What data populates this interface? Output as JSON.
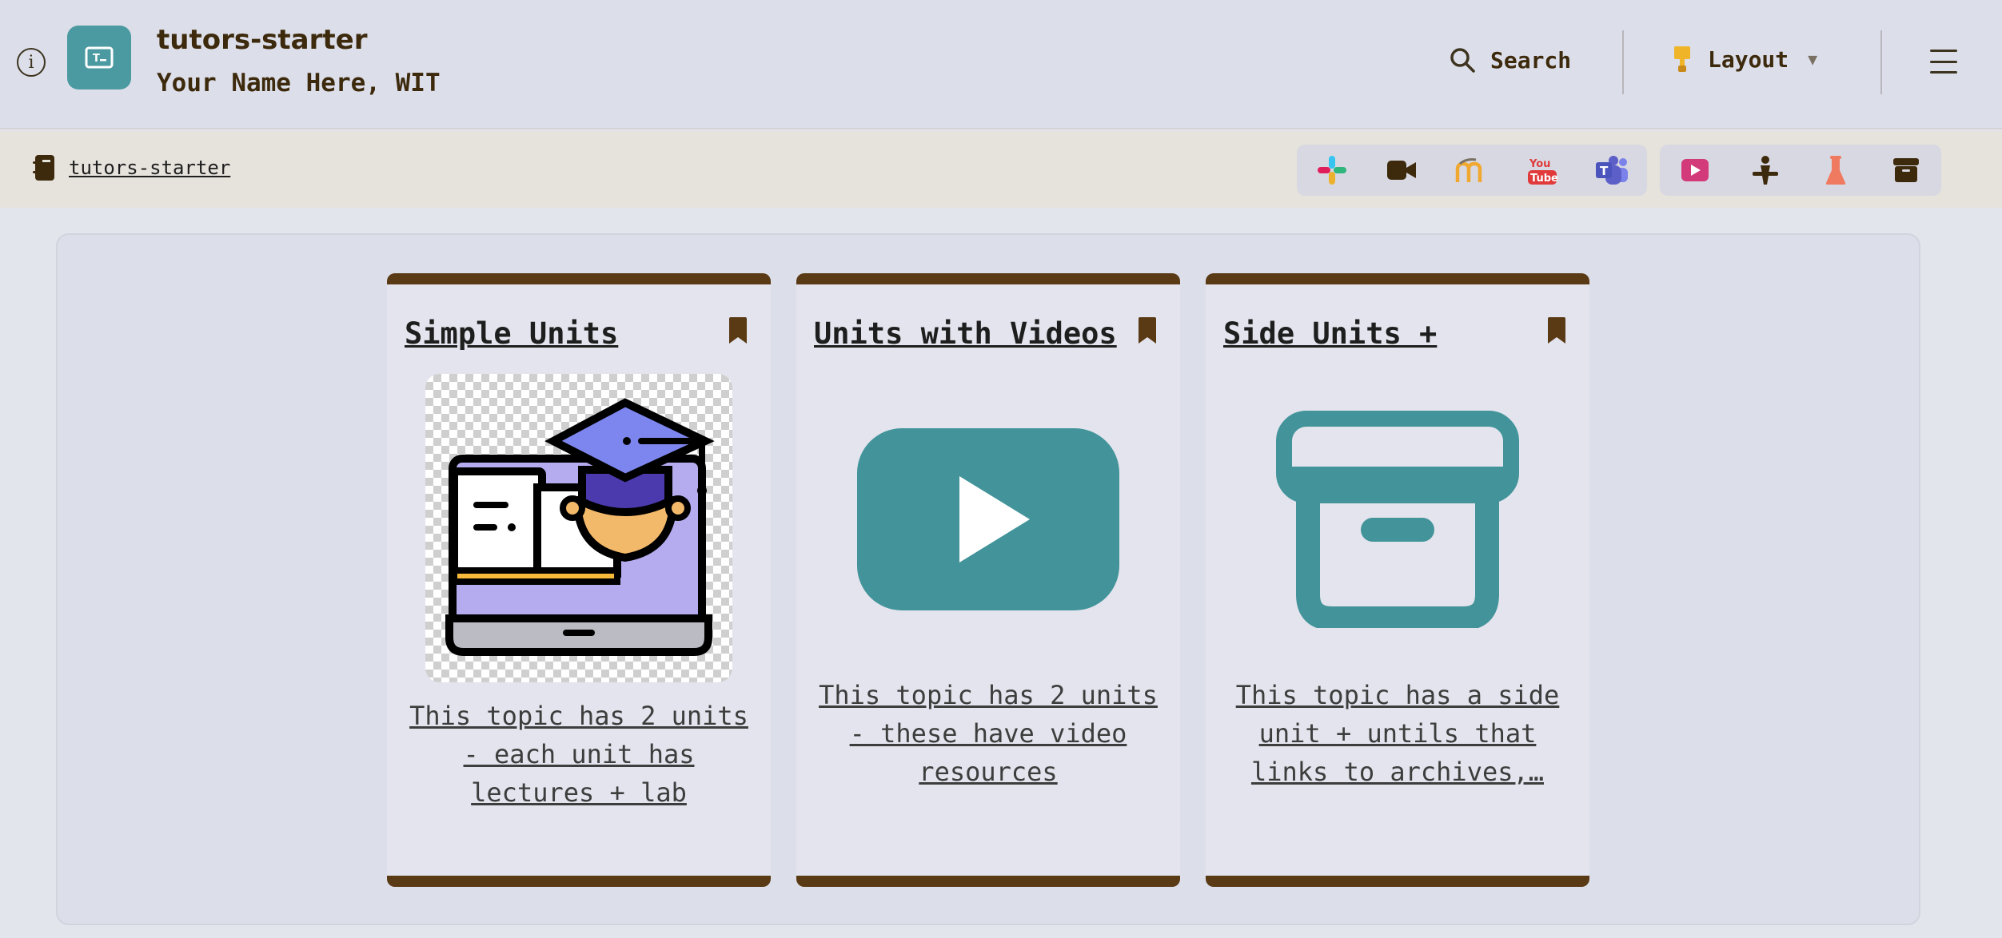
{
  "header": {
    "title": "tutors-starter",
    "subtitle": "Your Name Here, WIT",
    "search_label": "Search",
    "layout_label": "Layout",
    "icons": [
      "info-icon",
      "tutors-logo-icon",
      "search-icon",
      "paintbrush-icon",
      "chevron-down-icon",
      "menu-icon"
    ]
  },
  "breadcrumb": {
    "label": "tutors-starter",
    "icon": "notebook-icon"
  },
  "toolbar": {
    "group1": [
      "slack-icon",
      "video-camera-icon",
      "moodle-icon",
      "youtube-icon",
      "teams-icon"
    ],
    "group2": [
      "video-play-icon",
      "lab-station-icon",
      "flask-icon",
      "archive-icon"
    ],
    "colors": {
      "slack": "#e01e5a",
      "video": "#3d2a0d",
      "moodle": "#f0a830",
      "youtube": "#e03a3a",
      "teams": "#5b5fc7",
      "play": "#d23a7a",
      "lab": "#3d2a0d",
      "flask": "#f07a60",
      "archive": "#3d2a0d"
    }
  },
  "cards": [
    {
      "title": "Simple Units",
      "description": "This topic has 2 units - each unit has lectures + lab",
      "image": "graduate-laptop-illustration"
    },
    {
      "title": "Units with Videos",
      "description": "This topic has 2 units - these have video resources",
      "image": "youtube-play-icon"
    },
    {
      "title": "Side Units +",
      "description": "This topic has a side unit + untils that links to archives,…",
      "image": "archive-box-icon"
    }
  ],
  "colors": {
    "accent": "#4b9aa1",
    "brown": "#5a3a14",
    "text": "#3d2a0d"
  }
}
